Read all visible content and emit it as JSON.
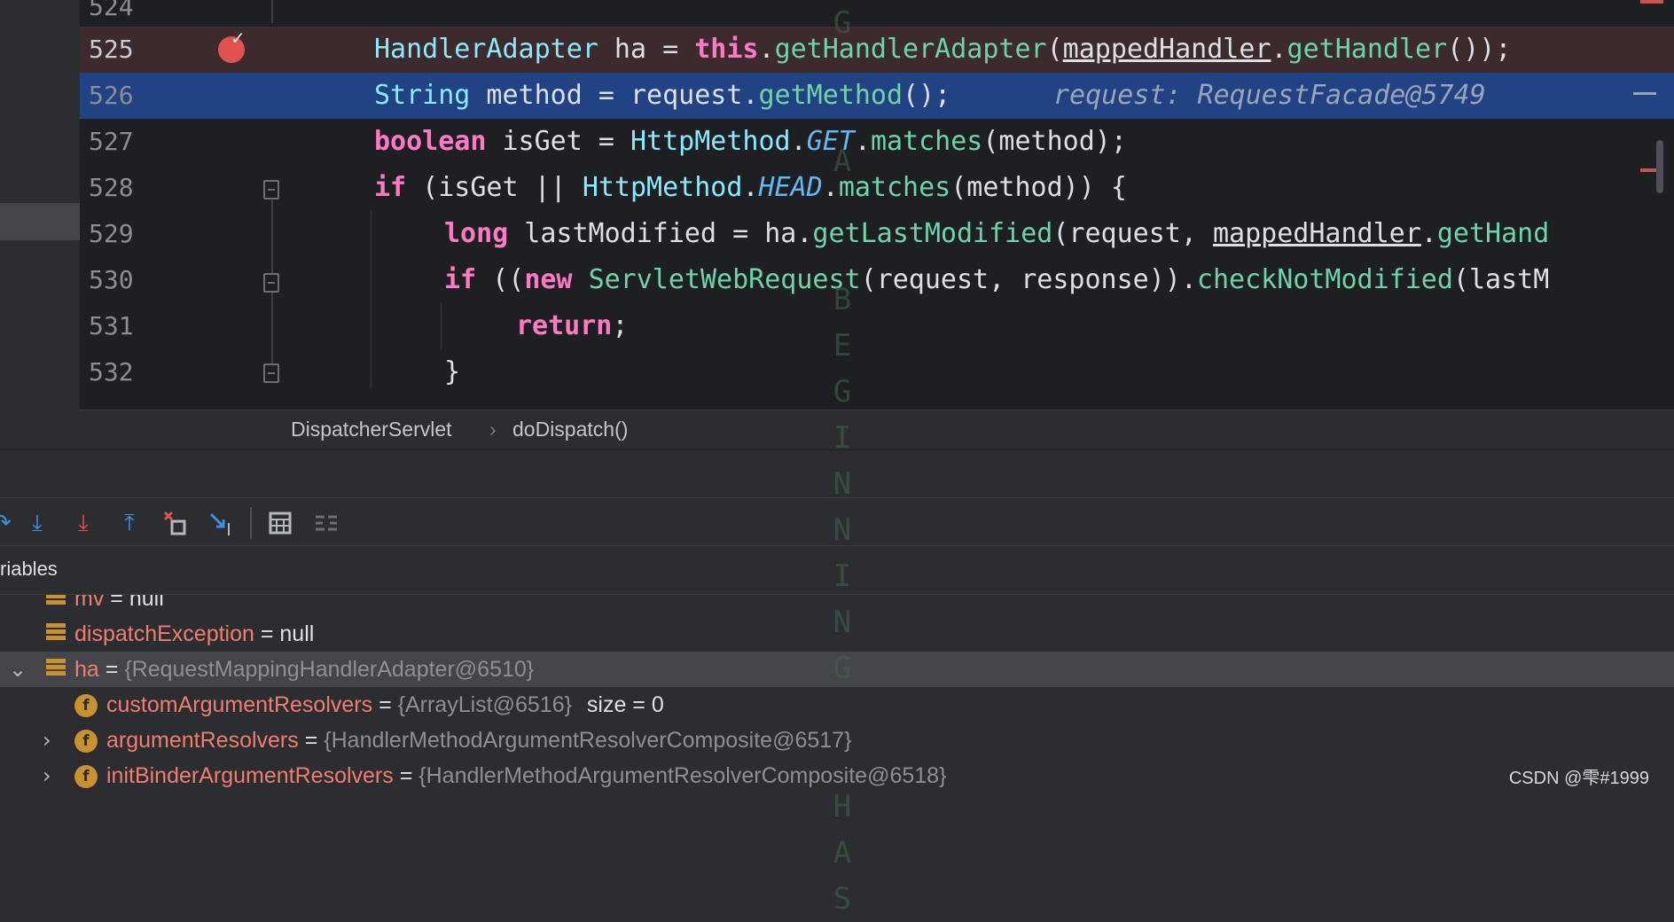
{
  "editor": {
    "lines": [
      {
        "num": "524"
      },
      {
        "num": "525"
      },
      {
        "num": "526",
        "hint": "request: RequestFacade@5749"
      },
      {
        "num": "527"
      },
      {
        "num": "528"
      },
      {
        "num": "529"
      },
      {
        "num": "530"
      },
      {
        "num": "531"
      },
      {
        "num": "532"
      }
    ],
    "code": {
      "l525": [
        "HandlerAdapter",
        " ha = ",
        "this",
        ".",
        "getHandlerAdapter",
        "(",
        "mappedHandler",
        ".",
        "getHandler",
        "());"
      ],
      "l526": [
        "String",
        " method = request.",
        "getMethod",
        "();"
      ],
      "l527": [
        "boolean",
        " isGet = ",
        "HttpMethod",
        ".",
        "GET",
        ".",
        "matches",
        "(method);"
      ],
      "l528": [
        "if",
        " (isGet || ",
        "HttpMethod",
        ".",
        "HEAD",
        ".",
        "matches",
        "(method)) {"
      ],
      "l529": [
        "long",
        " lastModified = ha.",
        "getLastModified",
        "(request, ",
        "mappedHandler",
        ".",
        "getHand"
      ],
      "l530": [
        "if",
        " ((",
        "new",
        " ",
        "ServletWebRequest",
        "(request, response)).",
        "checkNotModified",
        "(lastM"
      ],
      "l531": [
        "return",
        ";"
      ],
      "l532": [
        "}"
      ]
    }
  },
  "breadcrumb": {
    "class": "DispatcherServlet",
    "sep": "›",
    "method": "doDispatch()"
  },
  "variables": {
    "header": "riables",
    "rows": [
      {
        "name": "mv",
        "eq": " = ",
        "value": "null"
      },
      {
        "name": "dispatchException",
        "eq": " = ",
        "value": "null"
      },
      {
        "name": "ha",
        "eq": " = ",
        "value": "{RequestMappingHandlerAdapter@6510}"
      },
      {
        "name": "customArgumentResolvers",
        "eq": " = ",
        "value": "{ArrayList@6516}",
        "extra": "size = 0"
      },
      {
        "name": "argumentResolvers",
        "eq": " = ",
        "value": "{HandlerMethodArgumentResolverComposite@6517}"
      },
      {
        "name": "initBinderArgumentResolvers",
        "eq": " = ",
        "value": "{HandlerMethodArgumentResolverComposite@6518}"
      }
    ]
  },
  "toolbar": {
    "icons": [
      "step-over-icon",
      "step-into-icon",
      "force-step-into-icon",
      "step-out-icon",
      "drop-frame-icon",
      "run-to-cursor-icon",
      "evaluate-expression-icon",
      "trace-icon"
    ]
  },
  "matrix_text": "G  A  BEGINNING  HAS",
  "watermark": "CSDN @雫#1999",
  "colors": {
    "accent": "#214283",
    "breakpoint": "#e05252",
    "keyword": "#ff79c6",
    "type": "#8be9fd"
  }
}
